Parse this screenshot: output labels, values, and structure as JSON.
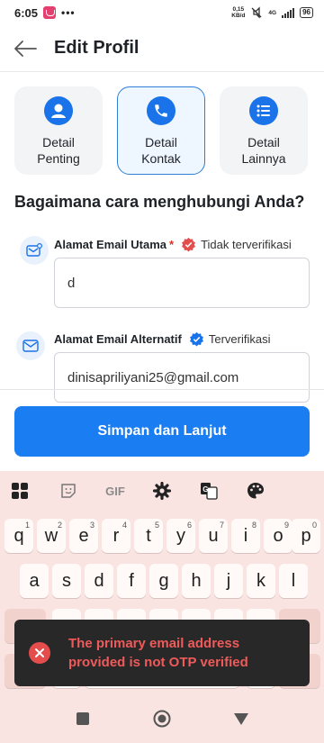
{
  "status_bar": {
    "time": "6:05",
    "dots": "•••",
    "speed_value": "0,15",
    "speed_unit": "KB/d",
    "network": "4G",
    "battery": "96"
  },
  "header": {
    "title": "Edit Profil"
  },
  "tabs": [
    {
      "label_line1": "Detail",
      "label_line2": "Penting",
      "icon": "person-icon",
      "active": false
    },
    {
      "label_line1": "Detail",
      "label_line2": "Kontak",
      "icon": "phone-icon",
      "active": true
    },
    {
      "label_line1": "Detail",
      "label_line2": "Lainnya",
      "icon": "list-icon",
      "active": false
    }
  ],
  "section_title": "Bagaimana cara menghubungi Anda?",
  "primary_email": {
    "label": "Alamat Email Utama",
    "required_mark": "*",
    "status": "Tidak terverifikasi",
    "status_color": "#e54d4d",
    "value": "d"
  },
  "alt_email": {
    "label": "Alamat Email Alternatif",
    "status": "Terverifikasi",
    "status_color": "#1a73e8",
    "value": "dinisapriliyani25@gmail.com"
  },
  "save_button": {
    "label": "Simpan dan Lanjut",
    "color": "#1a7ef2"
  },
  "keyboard": {
    "toolbar": [
      "apps-grid-icon",
      "sticker-icon",
      "GIF",
      "settings-gear-icon",
      "translate-icon",
      "palette-icon"
    ],
    "row1": [
      {
        "k": "q",
        "n": "1"
      },
      {
        "k": "w",
        "n": "2"
      },
      {
        "k": "e",
        "n": "3"
      },
      {
        "k": "r",
        "n": "4"
      },
      {
        "k": "t",
        "n": "5"
      },
      {
        "k": "y",
        "n": "6"
      },
      {
        "k": "u",
        "n": "7"
      },
      {
        "k": "i",
        "n": "8"
      },
      {
        "k": "o",
        "n": "9"
      },
      {
        "k": "p",
        "n": "0"
      }
    ],
    "row2": [
      "a",
      "s",
      "d",
      "f",
      "g",
      "h",
      "j",
      "k",
      "l"
    ]
  },
  "toast": {
    "message": "The primary email address provided is not OTP verified",
    "color": "#e54d4d"
  }
}
